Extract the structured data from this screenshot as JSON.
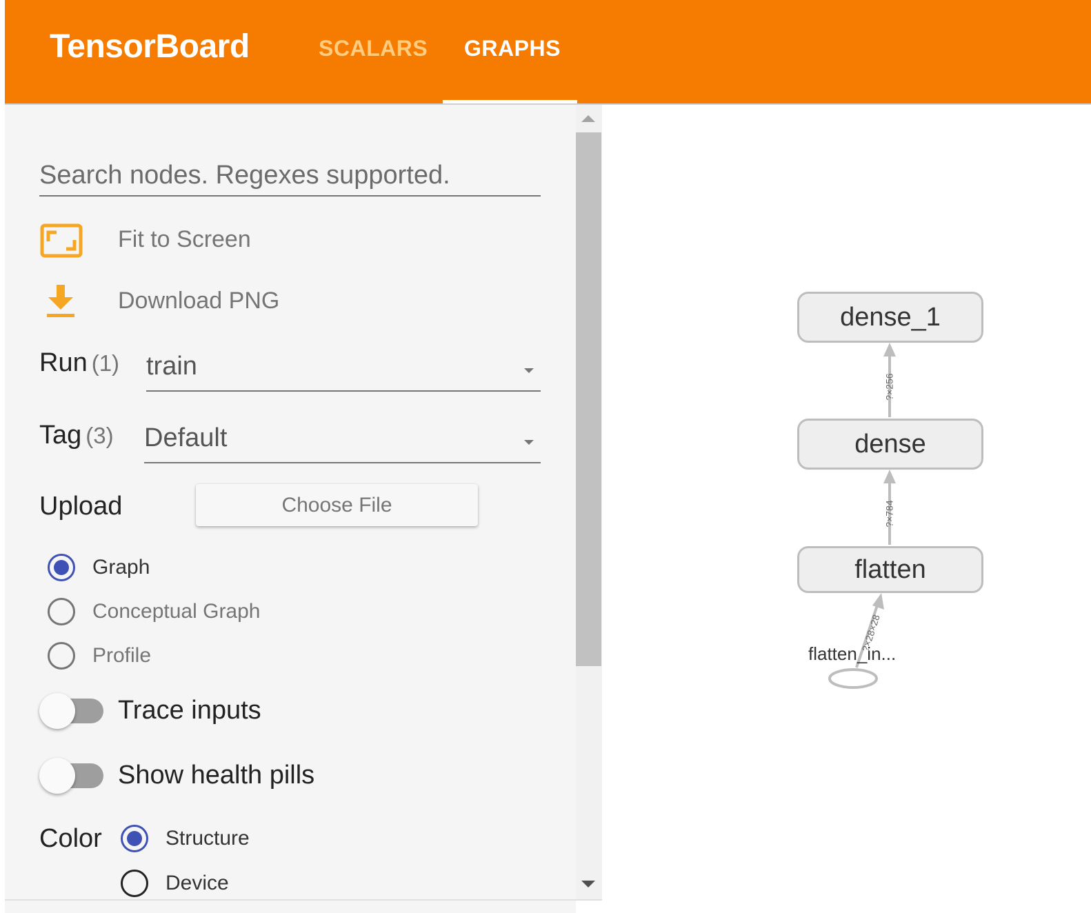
{
  "header": {
    "brand": "TensorBoard",
    "tabs": [
      {
        "label": "SCALARS",
        "active": false
      },
      {
        "label": "GRAPHS",
        "active": true
      }
    ],
    "accent_color": "#f57c00"
  },
  "sidebar": {
    "search": {
      "placeholder": "Search nodes. Regexes supported.",
      "value": ""
    },
    "actions": {
      "fit_to_screen": {
        "label": "Fit to Screen",
        "icon": "fit-screen-icon"
      },
      "download_png": {
        "label": "Download PNG",
        "icon": "download-icon"
      }
    },
    "run": {
      "label": "Run",
      "count": "(1)",
      "selected": "train"
    },
    "tag": {
      "label": "Tag",
      "count": "(3)",
      "selected": "Default"
    },
    "upload": {
      "label": "Upload",
      "button": "Choose File"
    },
    "graph_type": {
      "options": [
        {
          "label": "Graph",
          "checked": true
        },
        {
          "label": "Conceptual Graph",
          "checked": false
        },
        {
          "label": "Profile",
          "checked": false
        }
      ]
    },
    "toggles": {
      "trace_inputs": {
        "label": "Trace inputs",
        "on": false
      },
      "health_pills": {
        "label": "Show health pills",
        "on": false
      }
    },
    "color": {
      "label": "Color",
      "options": [
        {
          "label": "Structure",
          "checked": true
        },
        {
          "label": "Device",
          "checked": false
        }
      ]
    },
    "radio_color": "#3f51b5"
  },
  "graph": {
    "nodes": {
      "dense_1": "dense_1",
      "dense": "dense",
      "flatten": "flatten",
      "input": "flatten_in..."
    },
    "edges": {
      "dense_to_dense_1": "?×256",
      "flatten_to_dense": "?×784",
      "input_to_flatten": "?×28×28"
    }
  }
}
